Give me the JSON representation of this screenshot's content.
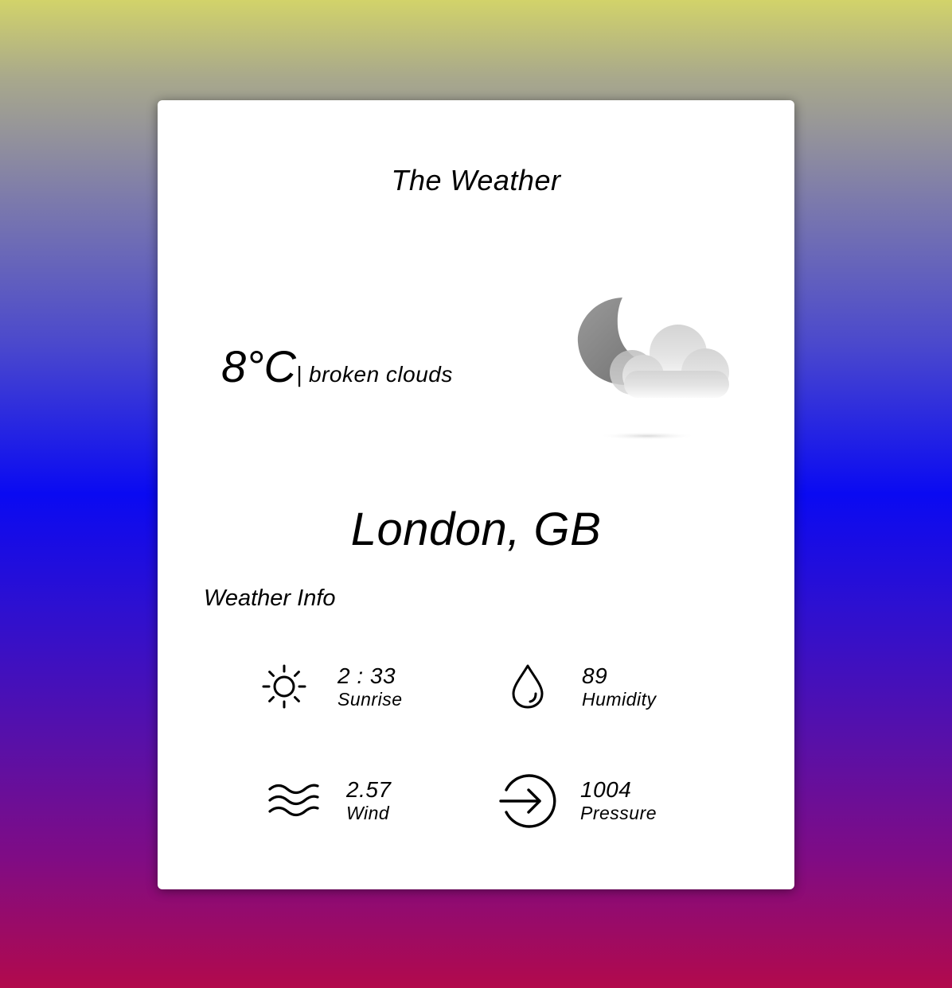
{
  "app": {
    "title": "The Weather"
  },
  "current": {
    "temperature": "8°C",
    "description": "| broken clouds",
    "icon": "night-broken-clouds-icon"
  },
  "location": {
    "city": "London, GB"
  },
  "info": {
    "heading": "Weather Info",
    "items": [
      {
        "icon": "sun-icon",
        "value": "2 : 33",
        "label": "Sunrise"
      },
      {
        "icon": "water-drop-icon",
        "value": "89",
        "label": "Humidity"
      },
      {
        "icon": "wind-waves-icon",
        "value": "2.57",
        "label": "Wind"
      },
      {
        "icon": "arrow-circle-right-icon",
        "value": "1004",
        "label": "Pressure"
      }
    ]
  }
}
